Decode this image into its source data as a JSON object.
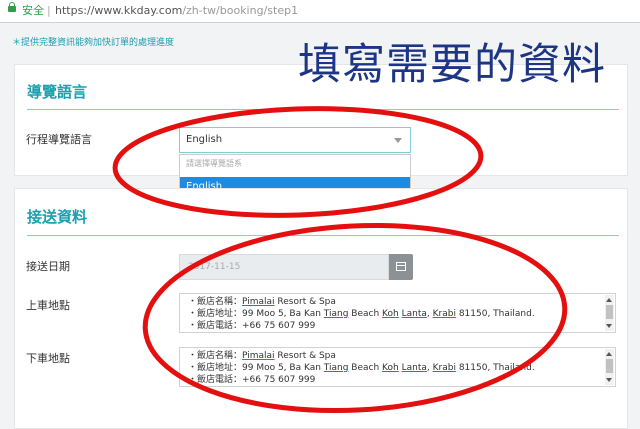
{
  "browser": {
    "secure_label": "安全",
    "url_base": "https://www.kkday.com",
    "url_path": "/zh-tw/booking/step1"
  },
  "notice": "＊提供完整資訊能夠加快訂單的處理進度",
  "annotation_text": "填寫需要的資料",
  "guide_section": {
    "title": "導覽語言",
    "field_label": "行程導覽語言",
    "selected_value": "English",
    "dropdown_placeholder": "請選擇導覽語系",
    "dropdown_option": "English"
  },
  "transfer_section": {
    "title": "接送資料",
    "date_label": "接送日期",
    "date_value": "2017-11-15",
    "pickup_label": "上車地點",
    "dropoff_label": "下車地點",
    "hotel_name_prefix": "・飯店名稱：",
    "hotel_name": "Pimalai",
    "hotel_name_rest": " Resort & Spa",
    "address_prefix": "・飯店地址：99 Moo 5, Ba Kan ",
    "address_tiang": "Tiang",
    "address_beach": " Beach ",
    "address_koh": "Koh",
    "address_space": " ",
    "address_lanta": "Lanta",
    "address_comma": ", ",
    "address_krabi": "Krabi",
    "address_rest": " 81150, Thailand.",
    "phone": "・飯店電話：+66 75 607 999"
  },
  "colors": {
    "accent": "#1aa0b0",
    "annotation_red": "#e41010",
    "annotation_blue": "#1d3585",
    "option_highlight": "#1e8be0"
  }
}
